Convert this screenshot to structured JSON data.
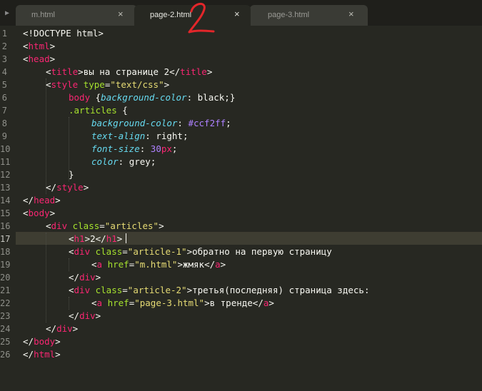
{
  "tabs": [
    {
      "label": "m.html",
      "close": "×",
      "active": false
    },
    {
      "label": "page-2.html",
      "close": "×",
      "active": true
    },
    {
      "label": "page-3.html",
      "close": "×",
      "active": false
    }
  ],
  "annotation": "2",
  "current_line": 17,
  "line_numbers": [
    "1",
    "2",
    "3",
    "4",
    "5",
    "6",
    "7",
    "8",
    "9",
    "10",
    "11",
    "12",
    "13",
    "14",
    "15",
    "16",
    "17",
    "18",
    "19",
    "20",
    "21",
    "22",
    "23",
    "24",
    "25",
    "26"
  ],
  "code": {
    "l1": {
      "open": "<!DOCTYPE html>"
    },
    "l2": {
      "open": "<",
      "tag": "html",
      "close": ">"
    },
    "l3": {
      "open": "<",
      "tag": "head",
      "close": ">"
    },
    "l4": {
      "open": "<",
      "tag": "title",
      "mid": ">вы на странице 2</",
      "tag2": "title",
      "close": ">"
    },
    "l5": {
      "open": "<",
      "tag": "style",
      "attr": " type",
      "eq": "=",
      "val": "\"text/css\"",
      "close": ">"
    },
    "l6": {
      "sel": "body ",
      "ob": "{",
      "prop": "background-color",
      "colon": ": ",
      "val": "black",
      "cb": ";}"
    },
    "l7": {
      "sel": ".articles ",
      "ob": "{"
    },
    "l8": {
      "prop": "background-color",
      "colon": ": ",
      "val": "#ccf2ff",
      "semi": ";"
    },
    "l9": {
      "prop": "text-align",
      "colon": ": ",
      "val": "right",
      "semi": ";"
    },
    "l10": {
      "prop": "font-size",
      "colon": ": ",
      "num": "30",
      "unit": "px",
      "semi": ";"
    },
    "l11": {
      "prop": "color",
      "colon": ": ",
      "val": "grey",
      "semi": ";"
    },
    "l12": {
      "cb": "}"
    },
    "l13": {
      "open": "</",
      "tag": "style",
      "close": ">"
    },
    "l14": {
      "open": "</",
      "tag": "head",
      "close": ">"
    },
    "l15": {
      "open": "<",
      "tag": "body",
      "close": ">"
    },
    "l16": {
      "open": "<",
      "tag": "div",
      "attr": " class",
      "eq": "=",
      "val": "\"articles\"",
      "close": ">"
    },
    "l17": {
      "open": "<",
      "tag": "h1",
      "mid": ">2</",
      "tag2": "h1",
      "close": ">"
    },
    "l18": {
      "open": "<",
      "tag": "div",
      "attr": " class",
      "eq": "=",
      "val": "\"article-1\"",
      "text": ">обратно на первую страницу"
    },
    "l19": {
      "open": "<",
      "tag": "a",
      "attr": " href",
      "eq": "=",
      "val": "\"m.html\"",
      "mid": ">жмяк</",
      "tag2": "a",
      "close": ">"
    },
    "l20": {
      "open": "</",
      "tag": "div",
      "close": ">"
    },
    "l21": {
      "open": "<",
      "tag": "div",
      "attr": " class",
      "eq": "=",
      "val": "\"article-2\"",
      "text": ">третья(последняя) страница здесь:"
    },
    "l22": {
      "open": "<",
      "tag": "a",
      "attr": " href",
      "eq": "=",
      "val": "\"page-3.html\"",
      "mid": ">в тренде</",
      "tag2": "a",
      "close": ">"
    },
    "l23": {
      "open": "</",
      "tag": "div",
      "close": ">"
    },
    "l24": {
      "open": "</",
      "tag": "div",
      "close": ">"
    },
    "l25": {
      "open": "</",
      "tag": "body",
      "close": ">"
    },
    "l26": {
      "open": "</",
      "tag": "html",
      "close": ">"
    }
  },
  "colors": {
    "background": "#272822",
    "tag": "#f92672",
    "attribute": "#a6e22e",
    "string": "#e6db74",
    "property": "#66d9ef",
    "number": "#ae81ff",
    "annotation": "#e3262a"
  },
  "icons": {
    "tab_scroll": "play-triangle-icon"
  }
}
